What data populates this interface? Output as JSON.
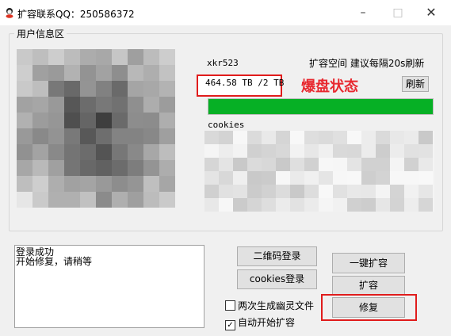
{
  "window": {
    "title": "扩容联系QQ：250586372",
    "minimize_glyph": "–",
    "maximize_glyph": "□",
    "close_glyph": "✕"
  },
  "user_info": {
    "group_label": "用户信息区",
    "username": "xkr523",
    "expand_hint": "扩容空间  建议每隔20s刷新",
    "quota": "464.58 TB /2 TB",
    "status": "爆盘状态",
    "refresh_label": "刷新",
    "progress_percent": 100,
    "progress_color": "#06b025",
    "cookies_label": "cookies"
  },
  "log": {
    "lines": [
      "登录成功",
      "开始修复，请稍等"
    ]
  },
  "actions": {
    "qr_login": "二维码登录",
    "cookies_login": "cookies登录",
    "one_key_expand": "一键扩容",
    "expand": "扩容",
    "repair": "修复"
  },
  "options": {
    "ghost_files": {
      "label": "两次生成幽灵文件",
      "checked": false
    },
    "auto_expand": {
      "label": "自动开始扩容",
      "checked": true
    }
  },
  "colors": {
    "highlight_red": "#e01c1c",
    "status_red": "#e8282f"
  }
}
